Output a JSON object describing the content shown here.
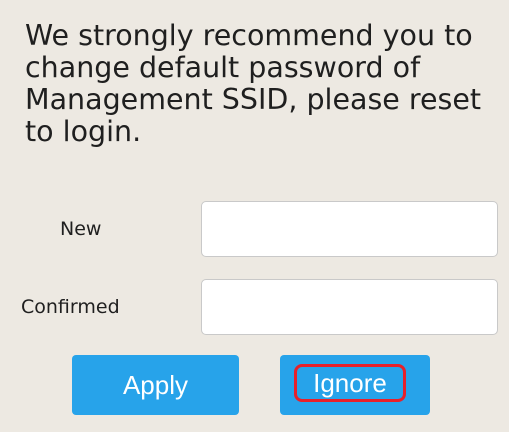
{
  "dialog": {
    "message": "We strongly recommend you to change default password of Management SSID, please reset to login."
  },
  "form": {
    "new_label": "New",
    "new_value": "",
    "confirmed_label": "Confirmed",
    "confirmed_value": ""
  },
  "actions": {
    "apply_label": "Apply",
    "ignore_label": "Ignore"
  },
  "colors": {
    "background": "#ede9e2",
    "button": "#27a3ea",
    "highlight": "#e8202a"
  }
}
